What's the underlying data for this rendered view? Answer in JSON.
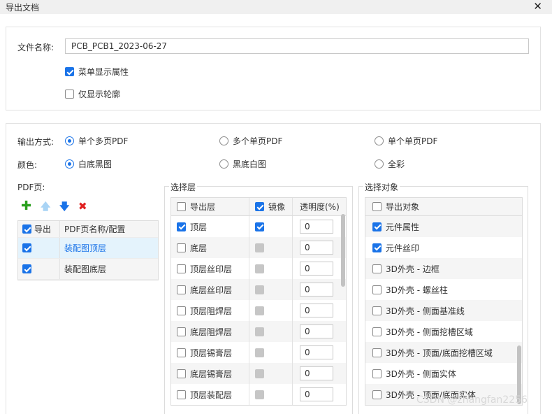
{
  "dialog": {
    "title": "导出文档",
    "close_icon": "close-icon"
  },
  "file": {
    "name_label": "文件名称:",
    "name_value": "PCB_PCB1_2023-06-27",
    "options": [
      {
        "label": "菜单显示属性",
        "checked": true
      },
      {
        "label": "仅显示轮廓",
        "checked": false
      }
    ]
  },
  "output": {
    "label": "输出方式:",
    "options": [
      {
        "label": "单个多页PDF",
        "selected": true
      },
      {
        "label": "多个单页PDF",
        "selected": false
      },
      {
        "label": "单个单页PDF",
        "selected": false
      }
    ]
  },
  "color": {
    "label": "颜色:",
    "options": [
      {
        "label": "白底黑图",
        "selected": true
      },
      {
        "label": "黑底白图",
        "selected": false
      },
      {
        "label": "全彩",
        "selected": false
      }
    ]
  },
  "pdf_pages": {
    "label": "PDF页:",
    "toolbar": {
      "add_icon": "plus-icon",
      "up_icon": "arrow-up-icon",
      "down_icon": "arrow-down-icon",
      "delete_icon": "delete-icon",
      "accent": "#1a73e8"
    },
    "header": {
      "export": "导出",
      "name": "PDF页名称/配置"
    },
    "rows": [
      {
        "name": "装配图顶层",
        "checked": true
      },
      {
        "name": "装配图底层",
        "checked": true
      }
    ]
  },
  "layers": {
    "title": "选择层",
    "header": {
      "export": "导出层",
      "mirror": "镜像",
      "opacity": "透明度(%)"
    },
    "rows": [
      {
        "name": "顶层",
        "checked": true,
        "mirror": true,
        "opacity": "0"
      },
      {
        "name": "底层",
        "checked": false,
        "mirror": false,
        "opacity": "0"
      },
      {
        "name": "顶层丝印层",
        "checked": false,
        "mirror": false,
        "opacity": "0"
      },
      {
        "name": "底层丝印层",
        "checked": false,
        "mirror": false,
        "opacity": "0"
      },
      {
        "name": "顶层阻焊层",
        "checked": false,
        "mirror": false,
        "opacity": "0"
      },
      {
        "name": "底层阻焊层",
        "checked": false,
        "mirror": false,
        "opacity": "0"
      },
      {
        "name": "顶层锡膏层",
        "checked": false,
        "mirror": false,
        "opacity": "0"
      },
      {
        "name": "底层锡膏层",
        "checked": false,
        "mirror": false,
        "opacity": "0"
      },
      {
        "name": "顶层装配层",
        "checked": false,
        "mirror": false,
        "opacity": "0"
      }
    ]
  },
  "objects": {
    "title": "选择对象",
    "header": "导出对象",
    "rows": [
      {
        "name": "元件属性",
        "checked": true
      },
      {
        "name": "元件丝印",
        "checked": true
      },
      {
        "name": "3D外壳 - 边框",
        "checked": false
      },
      {
        "name": "3D外壳 - 螺丝柱",
        "checked": false
      },
      {
        "name": "3D外壳 - 侧面基准线",
        "checked": false
      },
      {
        "name": "3D外壳 - 侧面挖槽区域",
        "checked": false
      },
      {
        "name": "3D外壳 - 顶面/底面挖槽区域",
        "checked": false
      },
      {
        "name": "3D外壳 - 侧面实体",
        "checked": false
      },
      {
        "name": "3D外壳 - 顶面/底面实体",
        "checked": false
      }
    ]
  },
  "watermark": "CSDN @zhangfan2256"
}
